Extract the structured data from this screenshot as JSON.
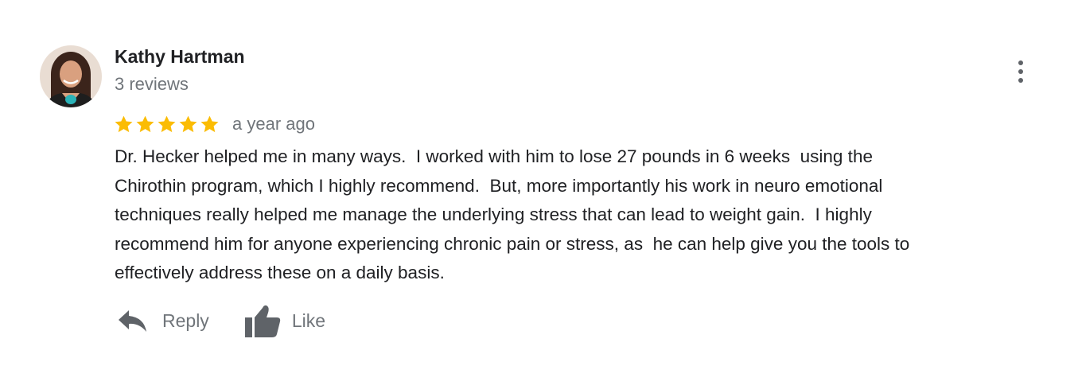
{
  "review": {
    "author": {
      "name": "Kathy Hartman",
      "reviews_count": "3 reviews",
      "avatar_icon": "profile-photo"
    },
    "rating": 5,
    "rating_max": 5,
    "time": "a year ago",
    "text": "Dr. Hecker helped me in many ways.  I worked with him to lose 27 pounds in 6 weeks  using the\nChirothin program, which I highly recommend.  But, more importantly his work in neuro emotional\ntechniques really helped me manage the underlying stress that can lead to weight gain.  I highly\nrecommend him for anyone experiencing chronic pain or stress, as  he can help give you the tools to\neffectively address these on a daily basis."
  },
  "actions": {
    "reply_label": "Reply",
    "like_label": "Like",
    "reply_icon": "reply-arrow",
    "like_icon": "thumbs-up",
    "more_icon": "vertical-ellipsis"
  },
  "colors": {
    "star": "#fbbc04",
    "name": "#202124",
    "secondary_text": "#70757a",
    "icon": "#5f6368"
  }
}
